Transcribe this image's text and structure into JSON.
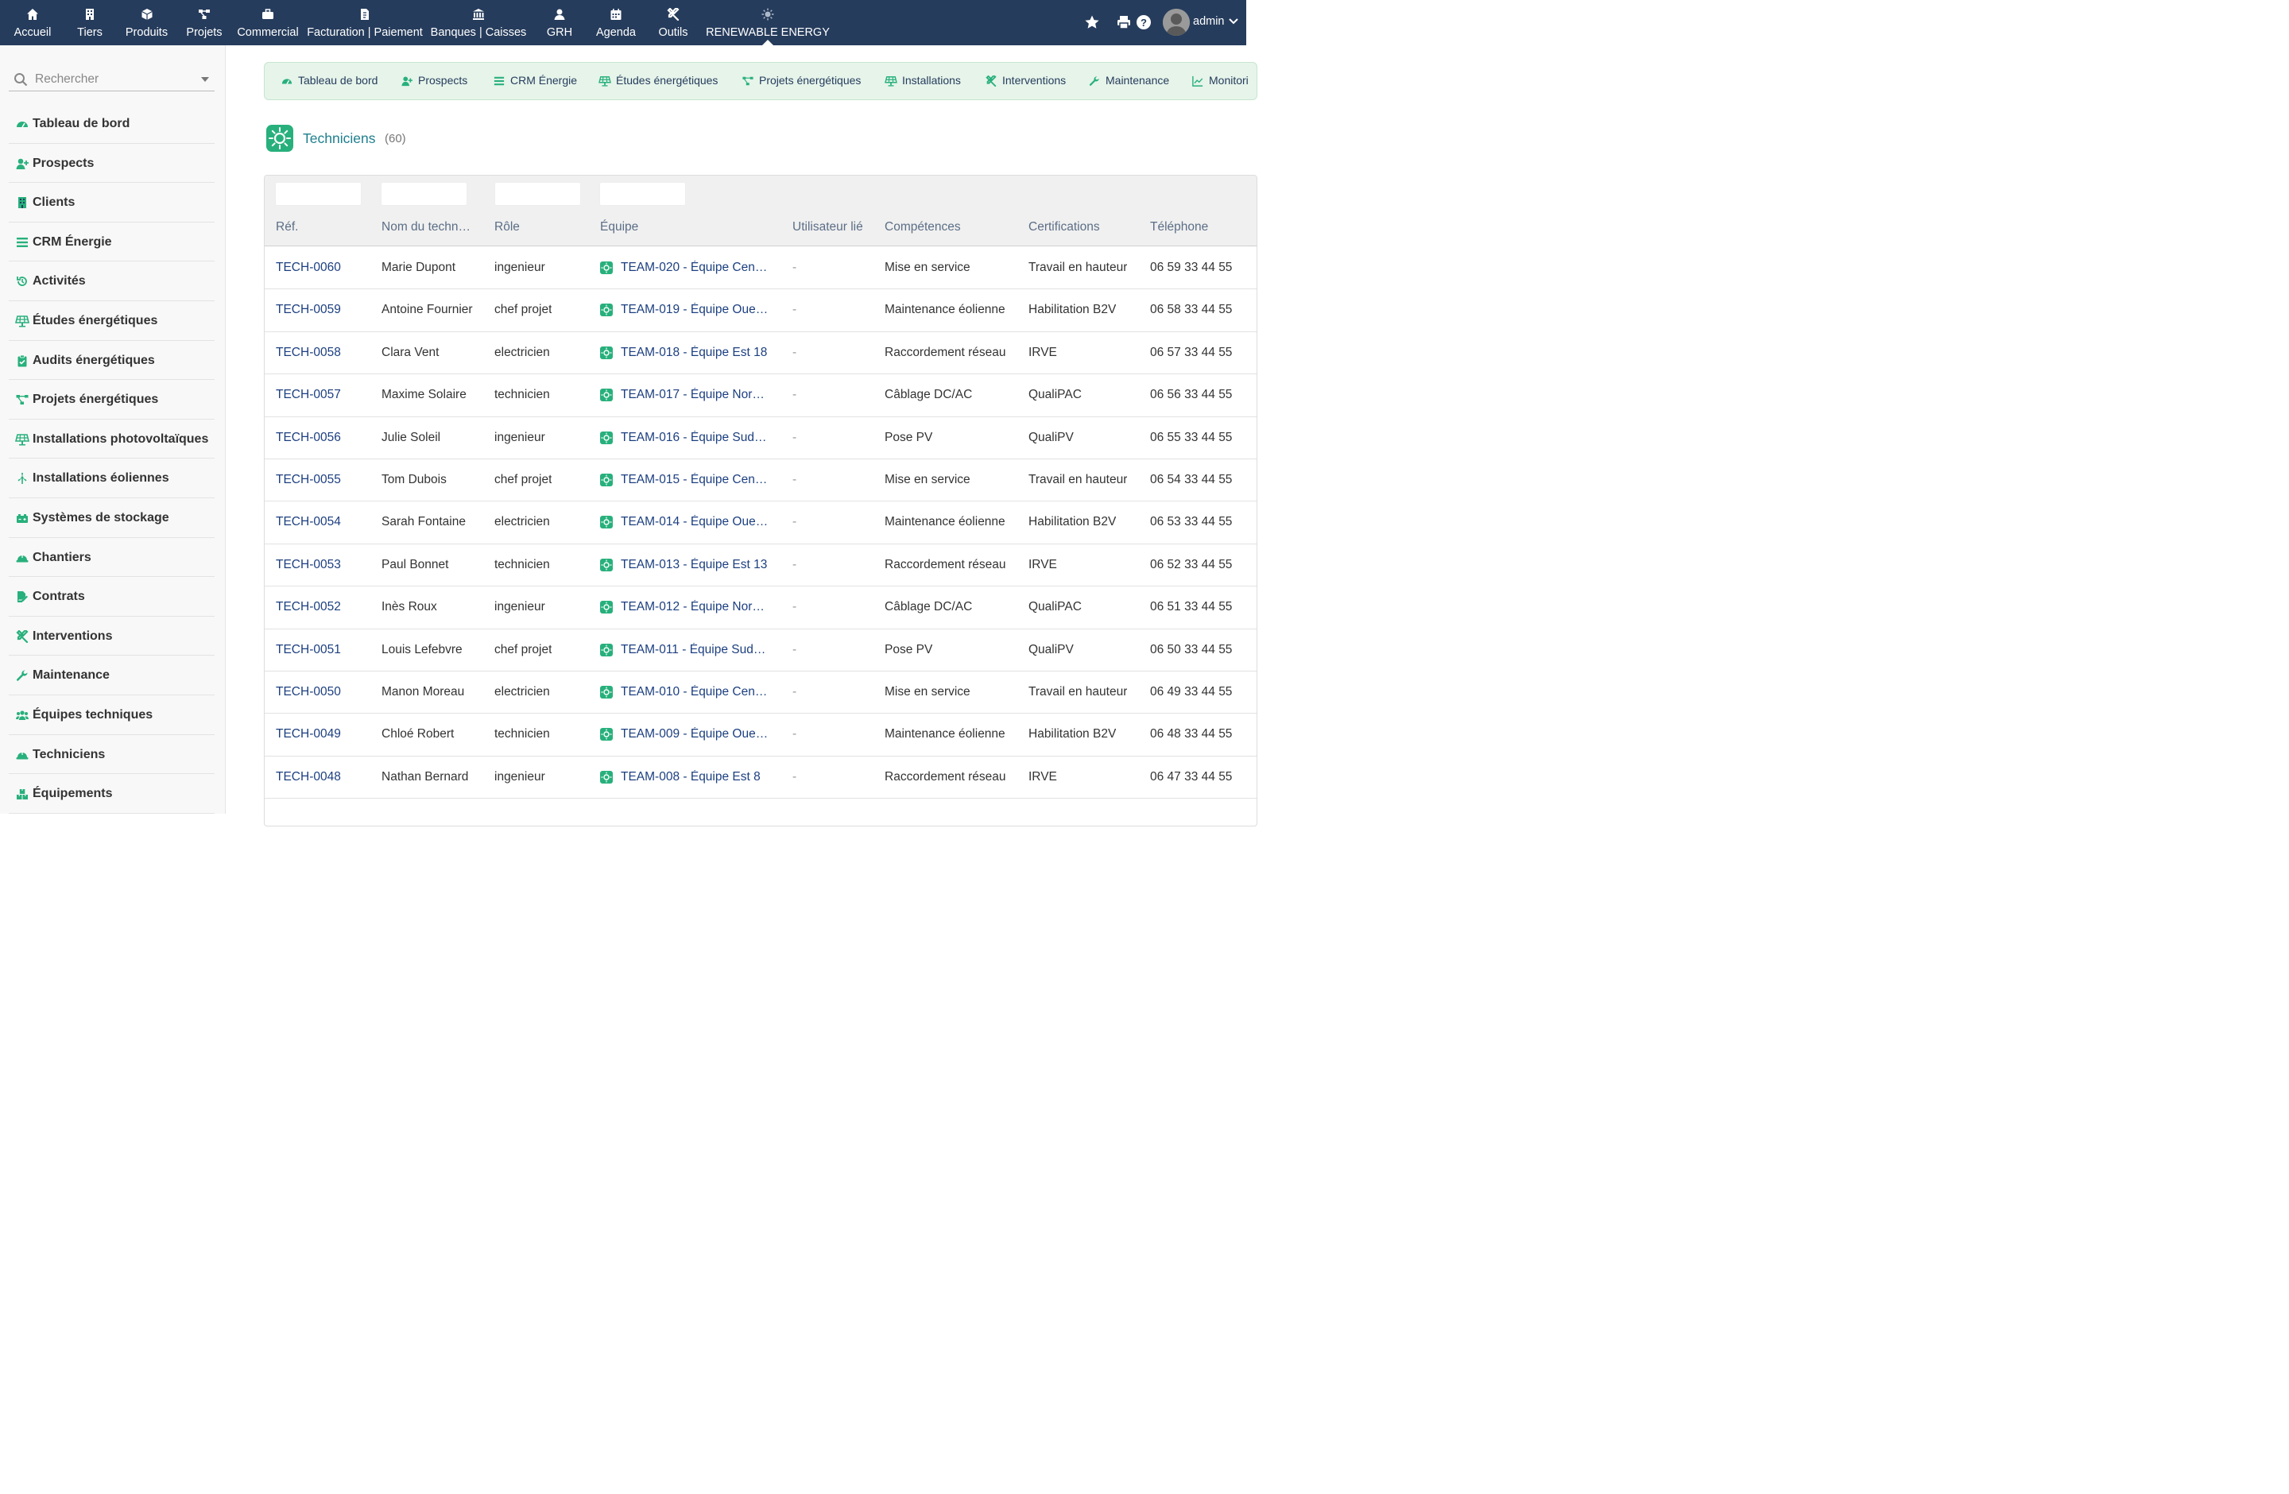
{
  "topmenu": {
    "items": [
      {
        "label": "Accueil",
        "icon": "home-icon"
      },
      {
        "label": "Tiers",
        "icon": "building-icon"
      },
      {
        "label": "Produits",
        "icon": "cube-icon"
      },
      {
        "label": "Projets",
        "icon": "project-icon"
      },
      {
        "label": "Commercial",
        "icon": "briefcase-icon"
      },
      {
        "label": "Facturation | Paiement",
        "icon": "invoice-icon"
      },
      {
        "label": "Banques | Caisses",
        "icon": "bank-icon"
      },
      {
        "label": "GRH",
        "icon": "user-icon"
      },
      {
        "label": "Agenda",
        "icon": "calendar-icon"
      },
      {
        "label": "Outils",
        "icon": "tools-icon"
      },
      {
        "label": "RENEWABLE ENERGY",
        "icon": "sun-icon"
      }
    ],
    "active_index": 10,
    "username": "admin"
  },
  "sidebar": {
    "search_placeholder": "Rechercher",
    "items": [
      {
        "label": "Tableau de bord",
        "icon": "dashboard-icon"
      },
      {
        "label": "Prospects",
        "icon": "user-plus-icon"
      },
      {
        "label": "Clients",
        "icon": "building-icon"
      },
      {
        "label": "CRM Énergie",
        "icon": "list-icon"
      },
      {
        "label": "Activités",
        "icon": "history-icon"
      },
      {
        "label": "Études énergétiques",
        "icon": "solar-panel-icon"
      },
      {
        "label": "Audits énergétiques",
        "icon": "clipboard-check-icon"
      },
      {
        "label": "Projets énergétiques",
        "icon": "project-diagram-icon"
      },
      {
        "label": "Installations photovoltaïques",
        "icon": "solar-panel-icon"
      },
      {
        "label": "Installations éoliennes",
        "icon": "wind-turbine-icon"
      },
      {
        "label": "Systèmes de stockage",
        "icon": "battery-icon"
      },
      {
        "label": "Chantiers",
        "icon": "hard-hat-icon"
      },
      {
        "label": "Contrats",
        "icon": "file-signature-icon"
      },
      {
        "label": "Interventions",
        "icon": "tools-icon"
      },
      {
        "label": "Maintenance",
        "icon": "wrench-icon"
      },
      {
        "label": "Équipes techniques",
        "icon": "users-icon"
      },
      {
        "label": "Techniciens",
        "icon": "hard-hat-icon"
      },
      {
        "label": "Équipements",
        "icon": "boxes-icon"
      }
    ]
  },
  "submenu": {
    "items": [
      {
        "label": "Tableau de bord",
        "icon": "dashboard-icon"
      },
      {
        "label": "Prospects",
        "icon": "user-plus-icon"
      },
      {
        "label": "CRM Énergie",
        "icon": "list-icon"
      },
      {
        "label": "Études énergétiques",
        "icon": "solar-panel-icon"
      },
      {
        "label": "Projets énergétiques",
        "icon": "project-diagram-icon"
      },
      {
        "label": "Installations",
        "icon": "solar-panel-icon"
      },
      {
        "label": "Interventions",
        "icon": "tools-icon"
      },
      {
        "label": "Maintenance",
        "icon": "wrench-icon"
      },
      {
        "label": "Monitori",
        "icon": "chart-line-icon"
      }
    ]
  },
  "page": {
    "title": "Techniciens",
    "count": "(60)"
  },
  "table": {
    "columns": [
      "Réf.",
      "Nom du techn…",
      "Rôle",
      "Équipe",
      "Utilisateur lié",
      "Compétences",
      "Certifications",
      "Téléphone"
    ],
    "rows": [
      {
        "ref": "TECH-0060",
        "nom": "Marie Dupont",
        "role": "ingenieur",
        "equipe": "TEAM-020 - Équipe Cen…",
        "user": "-",
        "comp": "Mise en service",
        "cert": "Travail en hauteur",
        "tel": "06 59 33 44 55"
      },
      {
        "ref": "TECH-0059",
        "nom": "Antoine Fournier",
        "role": "chef projet",
        "equipe": "TEAM-019 - Équipe Oue…",
        "user": "-",
        "comp": "Maintenance éolienne",
        "cert": "Habilitation B2V",
        "tel": "06 58 33 44 55"
      },
      {
        "ref": "TECH-0058",
        "nom": "Clara Vent",
        "role": "electricien",
        "equipe": "TEAM-018 - Équipe Est 18",
        "user": "-",
        "comp": "Raccordement réseau",
        "cert": "IRVE",
        "tel": "06 57 33 44 55"
      },
      {
        "ref": "TECH-0057",
        "nom": "Maxime Solaire",
        "role": "technicien",
        "equipe": "TEAM-017 - Équipe Nor…",
        "user": "-",
        "comp": "Câblage DC/AC",
        "cert": "QualiPAC",
        "tel": "06 56 33 44 55"
      },
      {
        "ref": "TECH-0056",
        "nom": "Julie Soleil",
        "role": "ingenieur",
        "equipe": "TEAM-016 - Équipe Sud…",
        "user": "-",
        "comp": "Pose PV",
        "cert": "QualiPV",
        "tel": "06 55 33 44 55"
      },
      {
        "ref": "TECH-0055",
        "nom": "Tom Dubois",
        "role": "chef projet",
        "equipe": "TEAM-015 - Équipe Cen…",
        "user": "-",
        "comp": "Mise en service",
        "cert": "Travail en hauteur",
        "tel": "06 54 33 44 55"
      },
      {
        "ref": "TECH-0054",
        "nom": "Sarah Fontaine",
        "role": "electricien",
        "equipe": "TEAM-014 - Équipe Oue…",
        "user": "-",
        "comp": "Maintenance éolienne",
        "cert": "Habilitation B2V",
        "tel": "06 53 33 44 55"
      },
      {
        "ref": "TECH-0053",
        "nom": "Paul Bonnet",
        "role": "technicien",
        "equipe": "TEAM-013 - Équipe Est 13",
        "user": "-",
        "comp": "Raccordement réseau",
        "cert": "IRVE",
        "tel": "06 52 33 44 55"
      },
      {
        "ref": "TECH-0052",
        "nom": "Inès Roux",
        "role": "ingenieur",
        "equipe": "TEAM-012 - Équipe Nor…",
        "user": "-",
        "comp": "Câblage DC/AC",
        "cert": "QualiPAC",
        "tel": "06 51 33 44 55"
      },
      {
        "ref": "TECH-0051",
        "nom": "Louis Lefebvre",
        "role": "chef projet",
        "equipe": "TEAM-011 - Équipe Sud…",
        "user": "-",
        "comp": "Pose PV",
        "cert": "QualiPV",
        "tel": "06 50 33 44 55"
      },
      {
        "ref": "TECH-0050",
        "nom": "Manon Moreau",
        "role": "electricien",
        "equipe": "TEAM-010 - Équipe Cen…",
        "user": "-",
        "comp": "Mise en service",
        "cert": "Travail en hauteur",
        "tel": "06 49 33 44 55"
      },
      {
        "ref": "TECH-0049",
        "nom": "Chloé Robert",
        "role": "technicien",
        "equipe": "TEAM-009 - Équipe Oue…",
        "user": "-",
        "comp": "Maintenance éolienne",
        "cert": "Habilitation B2V",
        "tel": "06 48 33 44 55"
      },
      {
        "ref": "TECH-0048",
        "nom": "Nathan Bernard",
        "role": "ingenieur",
        "equipe": "TEAM-008 - Équipe Est 8",
        "user": "-",
        "comp": "Raccordement réseau",
        "cert": "IRVE",
        "tel": "06 47 33 44 55"
      }
    ]
  },
  "colors": {
    "topbar": "#263c5c",
    "accent_green": "#28b07c",
    "link_blue": "#1c3f80",
    "title_teal": "#1e7f8e",
    "submenu_bg": "#e6f4ea"
  }
}
